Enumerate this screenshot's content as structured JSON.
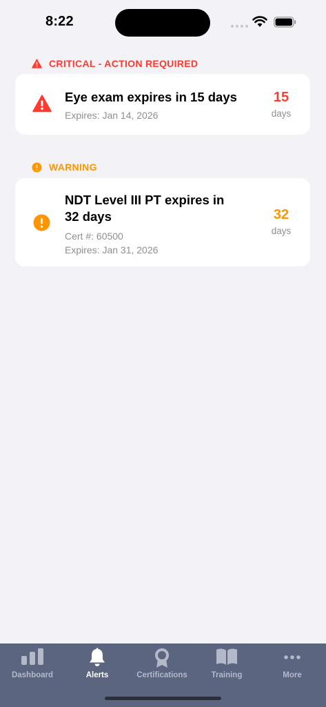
{
  "status_bar": {
    "time": "8:22"
  },
  "critical_section": {
    "header": "CRITICAL - ACTION REQUIRED",
    "color": "#ff3b30",
    "card": {
      "title": "Eye exam expires in 15 days",
      "expires": "Expires: Jan 14, 2026",
      "days_value": "15",
      "days_unit": "days"
    }
  },
  "warning_section": {
    "header": "WARNING",
    "color": "#ff9500",
    "card": {
      "title": "NDT Level III PT expires in 32 days",
      "cert": "Cert #: 60500",
      "expires": "Expires: Jan 31, 2026",
      "days_value": "32",
      "days_unit": "days"
    }
  },
  "tab_bar": {
    "background": "#5b6580",
    "tabs": [
      {
        "label": "Dashboard",
        "icon": "bar-chart-icon",
        "active": false
      },
      {
        "label": "Alerts",
        "icon": "bell-icon",
        "active": true
      },
      {
        "label": "Certifications",
        "icon": "award-ribbon-icon",
        "active": false
      },
      {
        "label": "Training",
        "icon": "book-icon",
        "active": false
      },
      {
        "label": "More",
        "icon": "more-dots-icon",
        "active": false
      }
    ]
  }
}
